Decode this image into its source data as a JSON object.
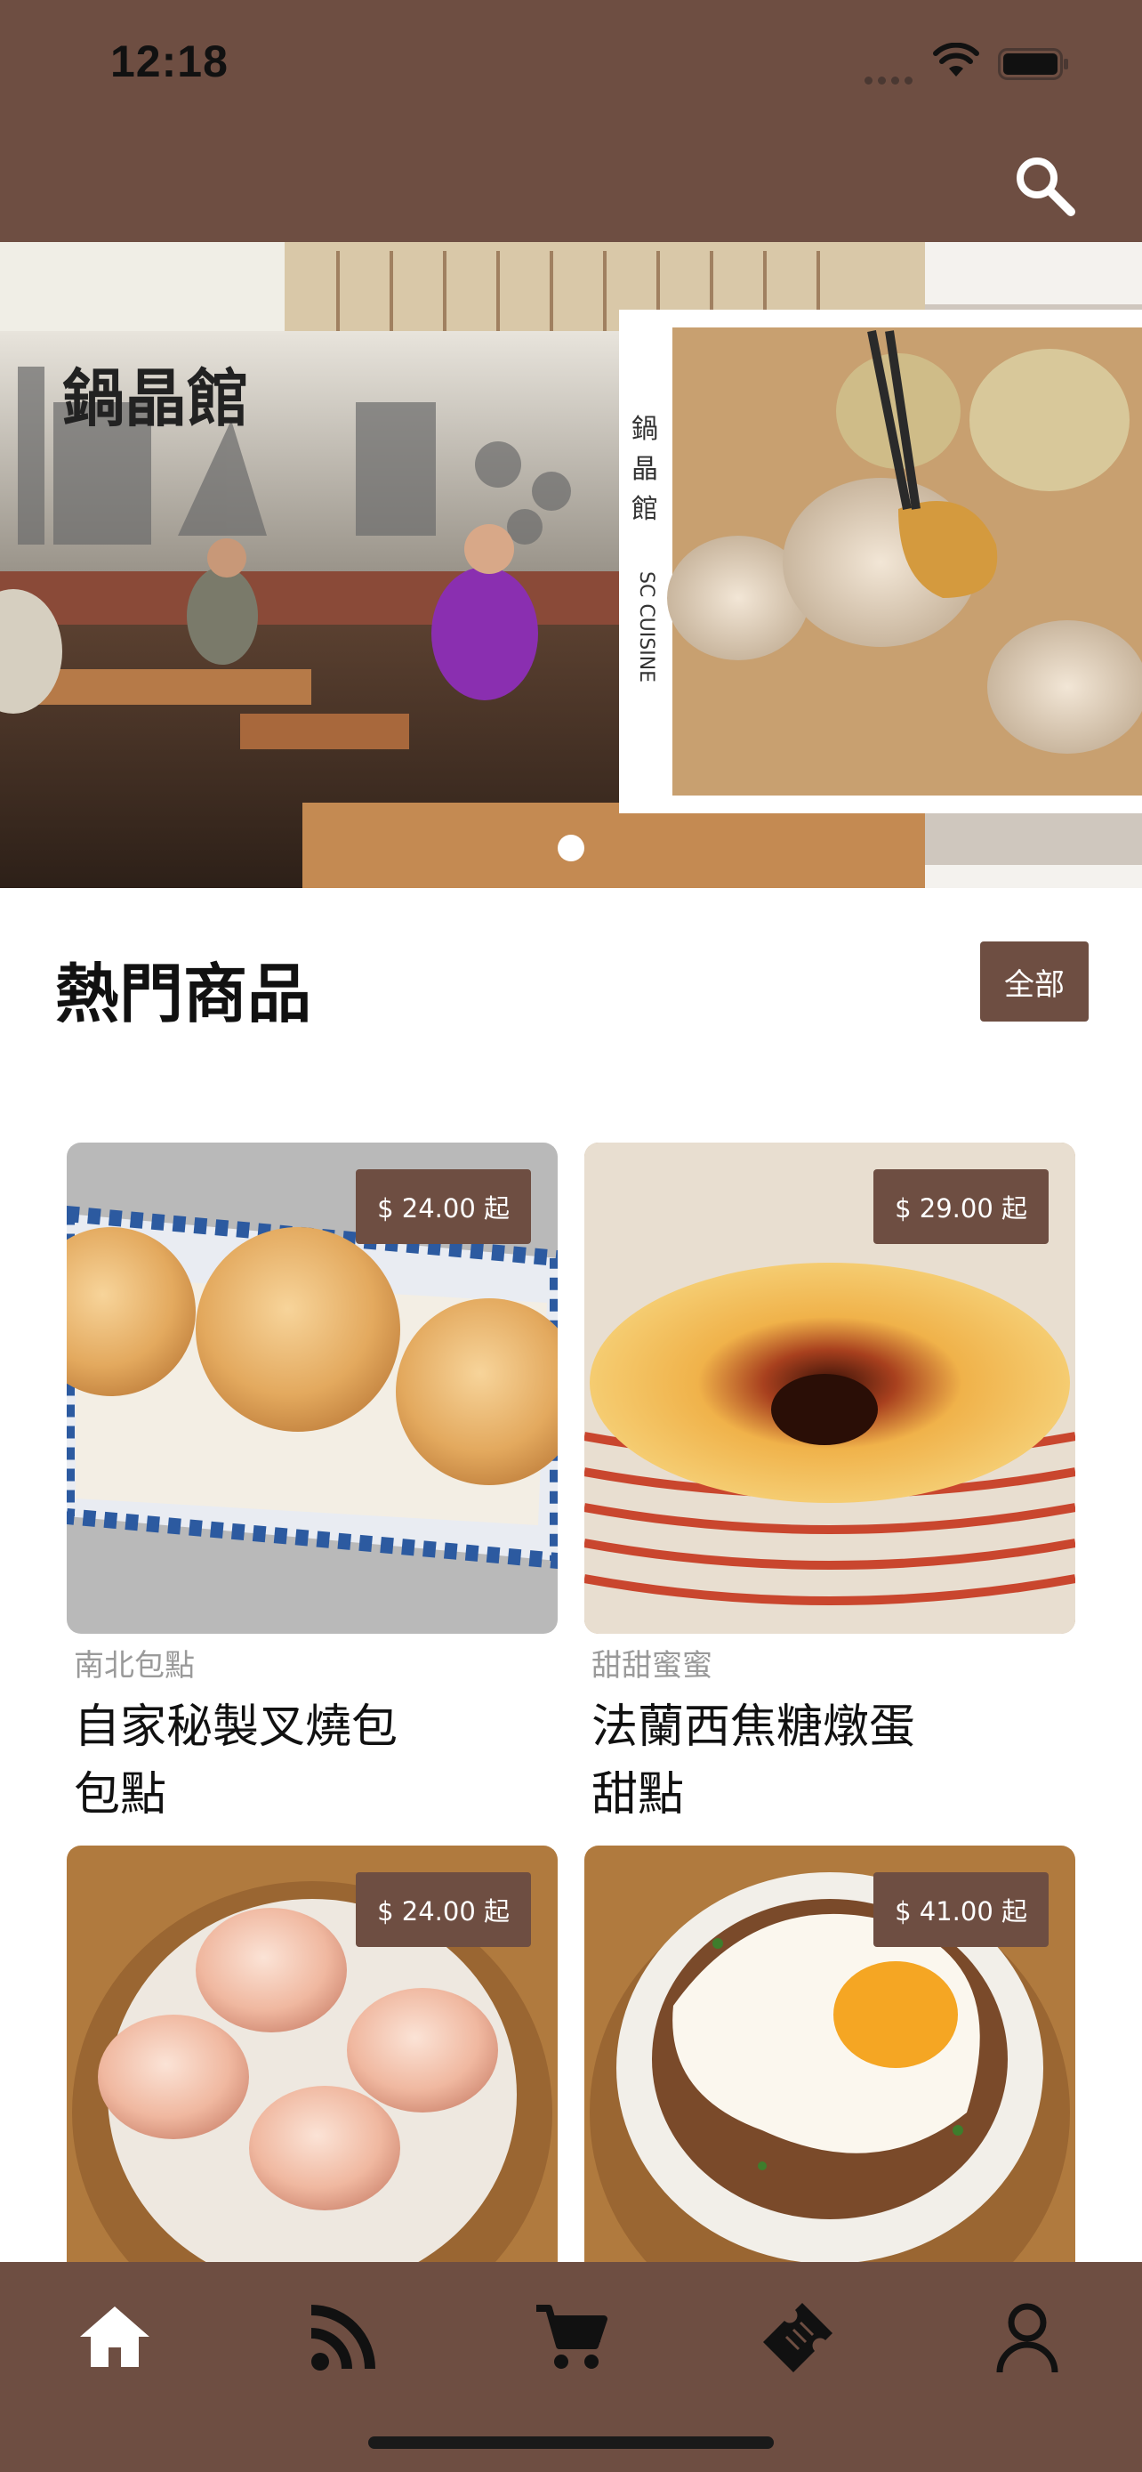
{
  "status_bar": {
    "time": "12:18",
    "icons": [
      "signal-icon",
      "wifi-icon",
      "battery-icon"
    ]
  },
  "header": {
    "search_icon": "search-icon"
  },
  "banner": {
    "active_slide": 1,
    "slide_count": 1
  },
  "section": {
    "title": "熱門商品",
    "all_button": "全部"
  },
  "products": [
    {
      "price": "$ 24.00 起",
      "category": "南北包點",
      "name": "自家秘製叉燒包",
      "subcategory": "包點"
    },
    {
      "price": "$ 29.00 起",
      "category": "甜甜蜜蜜",
      "name": "法蘭西焦糖燉蛋",
      "subcategory": "甜點"
    },
    {
      "price": "$ 24.00 起",
      "category": "",
      "name": "",
      "subcategory": ""
    },
    {
      "price": "$ 41.00 起",
      "category": "",
      "name": "",
      "subcategory": ""
    }
  ],
  "tab_bar": {
    "tabs": [
      "home-icon",
      "feed-icon",
      "cart-icon",
      "coupon-icon",
      "profile-icon"
    ],
    "active": "home-icon"
  },
  "colors": {
    "brand": "#6e4e42",
    "active_tab": "#ffffff",
    "inactive_tab": "#111111"
  }
}
